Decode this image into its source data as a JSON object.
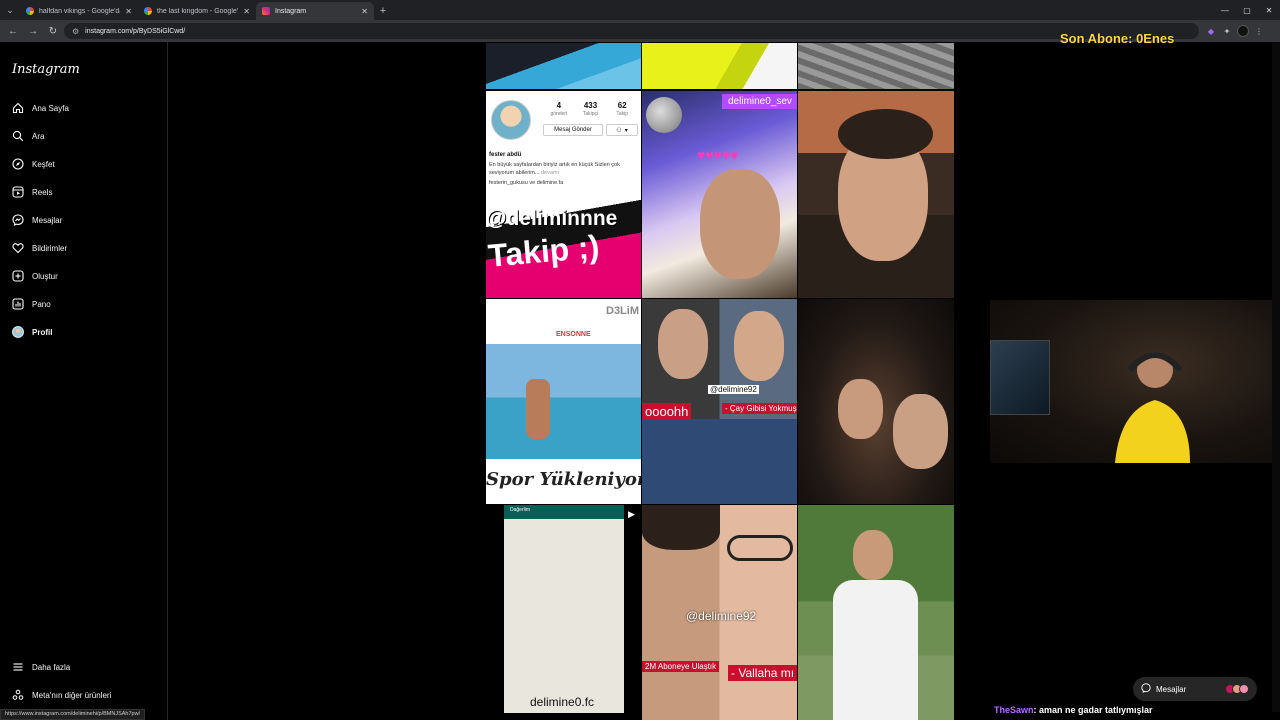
{
  "browser": {
    "tabs": [
      {
        "title": "halfdan vikings - Google'da Ara",
        "favicon": "google-icon",
        "active": false
      },
      {
        "title": "the last kingdom - Google'da A",
        "favicon": "google-icon",
        "active": false
      },
      {
        "title": "Instagram",
        "favicon": "instagram-icon",
        "active": true
      }
    ],
    "url": "instagram.com/p/ByDS5iGlCwd/",
    "status_url": "https://www.instagram.com/deliminehi/p/BMNJSAh7pw/"
  },
  "overlay": {
    "subscriber_text": "Son Abone: 0Enes"
  },
  "sidebar": {
    "logo": "Instagram",
    "items": [
      {
        "label": "Ana Sayfa",
        "icon": "home-icon"
      },
      {
        "label": "Ara",
        "icon": "search-icon"
      },
      {
        "label": "Keşfet",
        "icon": "compass-icon"
      },
      {
        "label": "Reels",
        "icon": "reels-icon"
      },
      {
        "label": "Mesajlar",
        "icon": "messenger-icon"
      },
      {
        "label": "Bildirimler",
        "icon": "heart-icon"
      },
      {
        "label": "Oluştur",
        "icon": "plus-square-icon"
      },
      {
        "label": "Pano",
        "icon": "dashboard-icon"
      },
      {
        "label": "Profil",
        "icon": "profile-avatar-icon"
      }
    ],
    "bottom": [
      {
        "label": "Daha fazla",
        "icon": "menu-icon"
      },
      {
        "label": "Meta'nın diğer ürünleri",
        "icon": "meta-products-icon"
      }
    ]
  },
  "posts": {
    "profile_card": {
      "stats": [
        {
          "value": "4",
          "label": "gönderi"
        },
        {
          "value": "433",
          "label": "Takipçi"
        },
        {
          "value": "62",
          "label": "Takip"
        }
      ],
      "message_button": "Mesaj Gönder",
      "name": "fester abdü",
      "bio": "En büyük sayfalardan biriyiz artık en küçük Sizleri çok seviyorum abilerim...",
      "bio_more": "devamı",
      "tags": "festerin_gukusu ve delimine.fa",
      "banner_line1": "@deliminnne",
      "banner_line2": "Takip ;)"
    },
    "labels": {
      "delimine0_sev": "delimine0_sev",
      "d3lim": "D3LiM",
      "ensonne": "ENSONNE",
      "spor": "Spor Yükleniyor...",
      "delimine92_a": "@delimine92",
      "oooohh": "oooohh",
      "cay": "- Çay Gibisi Yokmuş",
      "delimine92_b": "@delimine92",
      "aboneye": "2M Aboneye Ulaştık",
      "vallaha": "- Vallaha mı",
      "whatsapp_contact": "Dağerlim",
      "delimine0_fc": "delimine0.fc"
    }
  },
  "messages_pill": {
    "label": "Mesajlar"
  },
  "chat": {
    "user": "TheSawn",
    "text": ": aman ne gadar tatlıymışlar"
  },
  "colors": {
    "accent_pink": "#e6006f",
    "red_label": "#c8102e",
    "overlay_yellow": "#ffd54a",
    "chat_user": "#b96bff"
  }
}
